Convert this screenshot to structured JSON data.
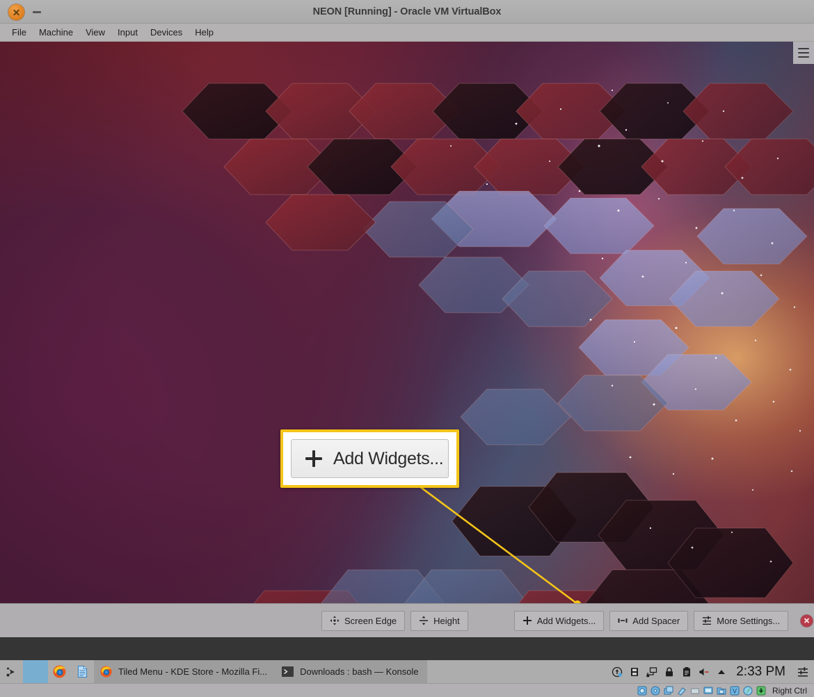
{
  "window": {
    "title": "NEON [Running] - Oracle VM VirtualBox",
    "close_icon": "close-circle-icon",
    "minimize_icon": "minimize-icon",
    "menu": [
      {
        "label": "File"
      },
      {
        "label": "Machine"
      },
      {
        "label": "View"
      },
      {
        "label": "Input"
      },
      {
        "label": "Devices"
      },
      {
        "label": "Help"
      }
    ]
  },
  "desktop": {
    "hamburger_icon": "hamburger-menu-icon",
    "wallpaper_name": "kde-neon-hexagon-nebula-wallpaper"
  },
  "callout": {
    "label": "Add Widgets...",
    "plus_icon": "plus-icon",
    "border_color": "#f5c518",
    "line_color": "#f5c518",
    "dot_color": "#f5c518"
  },
  "panel_config": {
    "buttons_left": [
      {
        "label": "Screen Edge",
        "icon": "move-arrows-icon"
      },
      {
        "label": "Height",
        "icon": "vertical-resize-icon"
      }
    ],
    "buttons_right": [
      {
        "label": "Add Widgets...",
        "icon": "plus-icon"
      },
      {
        "label": "Add Spacer",
        "icon": "spacer-icon"
      },
      {
        "label": "More Settings...",
        "icon": "settings-sliders-icon"
      }
    ],
    "close_icon": "close-circle-icon"
  },
  "taskbar": {
    "launchers": [
      {
        "icon": "application-launcher-icon",
        "name": "kde-menu"
      },
      {
        "icon": "blank-highlight-icon",
        "name": "active-slot"
      },
      {
        "icon": "firefox-icon",
        "name": "firefox-launcher"
      },
      {
        "icon": "text-document-icon",
        "name": "document-launcher"
      }
    ],
    "tasks": [
      {
        "icon": "firefox-icon",
        "title": "Tiled Menu - KDE Store - Mozilla Fi..."
      },
      {
        "icon": "konsole-icon",
        "title": "Downloads : bash — Konsole"
      }
    ],
    "tray": [
      {
        "icon": "system-update-icon"
      },
      {
        "icon": "usb-device-icon"
      },
      {
        "icon": "network-icon"
      },
      {
        "icon": "lock-icon"
      },
      {
        "icon": "clipboard-icon"
      },
      {
        "icon": "volume-icon"
      },
      {
        "icon": "show-hidden-arrow-icon"
      }
    ],
    "clock": "2:33 PM",
    "settings_icon": "panel-settings-icon"
  },
  "status_bar": {
    "icons": [
      {
        "icon": "hard-disk-icon"
      },
      {
        "icon": "optical-disk-icon"
      },
      {
        "icon": "floppy-icon"
      },
      {
        "icon": "audio-icon"
      },
      {
        "icon": "network-adapter-icon"
      },
      {
        "icon": "display-icon"
      },
      {
        "icon": "shared-folders-icon"
      },
      {
        "icon": "video-capture-icon"
      },
      {
        "icon": "mouse-integration-icon"
      },
      {
        "icon": "host-key-icon"
      }
    ],
    "host_key": "Right Ctrl"
  }
}
